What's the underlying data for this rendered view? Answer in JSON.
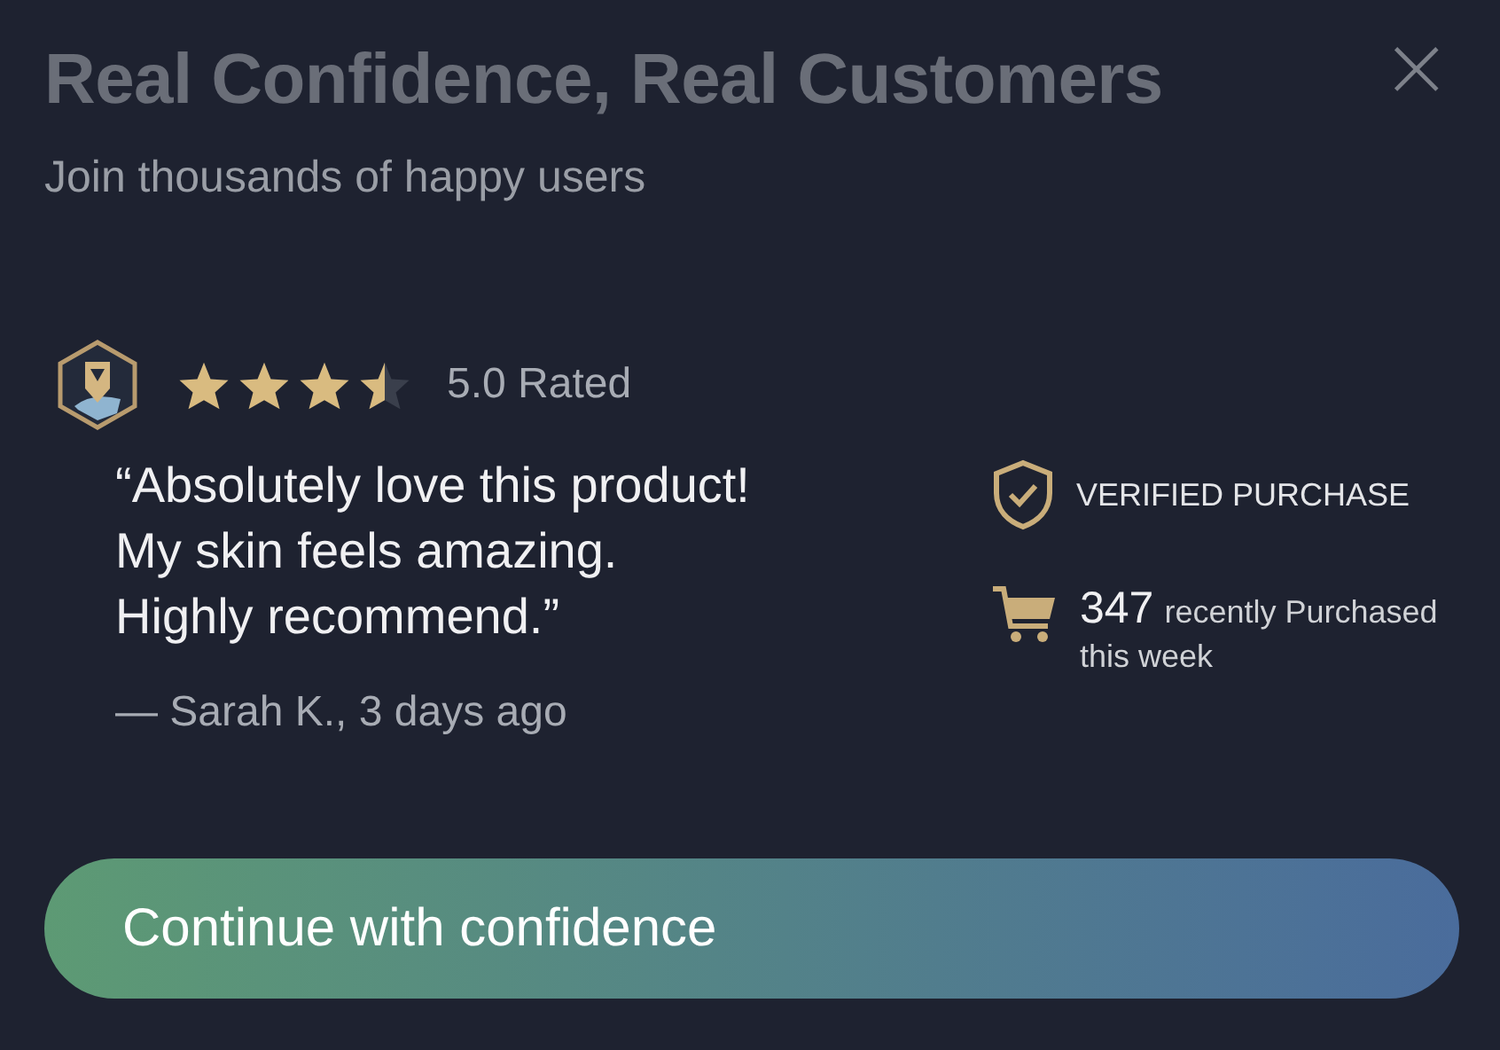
{
  "header": {
    "title": "Real Confidence, Real Customers",
    "subtitle": "Join thousands of happy users",
    "close": "×"
  },
  "rating": {
    "stars": 3.5,
    "label": "5.0 Rated"
  },
  "review": {
    "quote": [
      "“Absolutely love this product!",
      "My skin feels amazing.",
      "Highly recommend.”"
    ],
    "author": "— Sarah K., 3 days ago"
  },
  "badges": [
    {
      "kind": "verified",
      "text": "VERIFIED PURCHASE"
    },
    {
      "kind": "purchases",
      "count": "347",
      "text": "recently Purchased",
      "subtext": "this week"
    }
  ],
  "button": {
    "label": "Continue with confidence"
  }
}
